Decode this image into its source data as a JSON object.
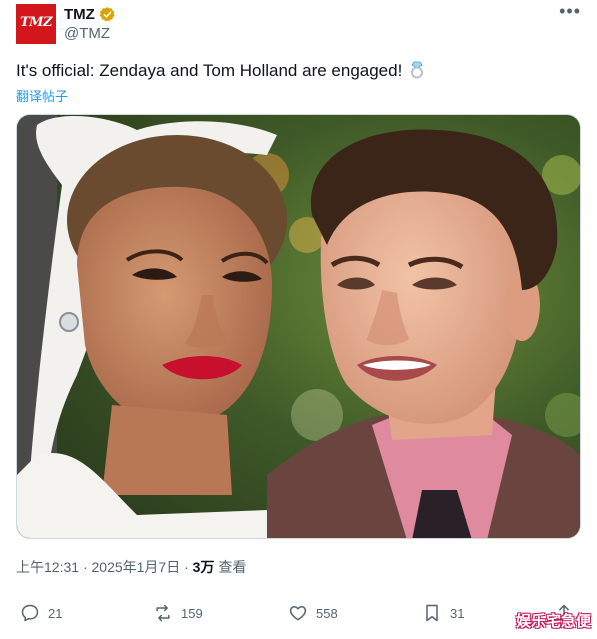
{
  "account": {
    "name": "TMZ",
    "handle": "@TMZ",
    "avatar_text": "TMZ",
    "verified_icon": "verified-badge-icon",
    "verified_color": "#d9a400",
    "avatar_color": "#d1161c"
  },
  "more_label": "•••",
  "tweet": {
    "text": "It's official: Zendaya and Tom Holland are engaged!",
    "emoji_icon": "ring-icon",
    "translate_label": "翻译帖子"
  },
  "meta": {
    "time": "上午12:31",
    "separator1": "·",
    "date": "2025年1月7日",
    "separator2": "·",
    "views_count": "3万",
    "views_label": "查看"
  },
  "actions": {
    "replies": "21",
    "reposts": "159",
    "likes": "558",
    "bookmarks": "31"
  },
  "watermark": "娱乐宅急便",
  "colors": {
    "link": "#1d9bf0",
    "muted": "#536471",
    "text": "#0f1419"
  }
}
